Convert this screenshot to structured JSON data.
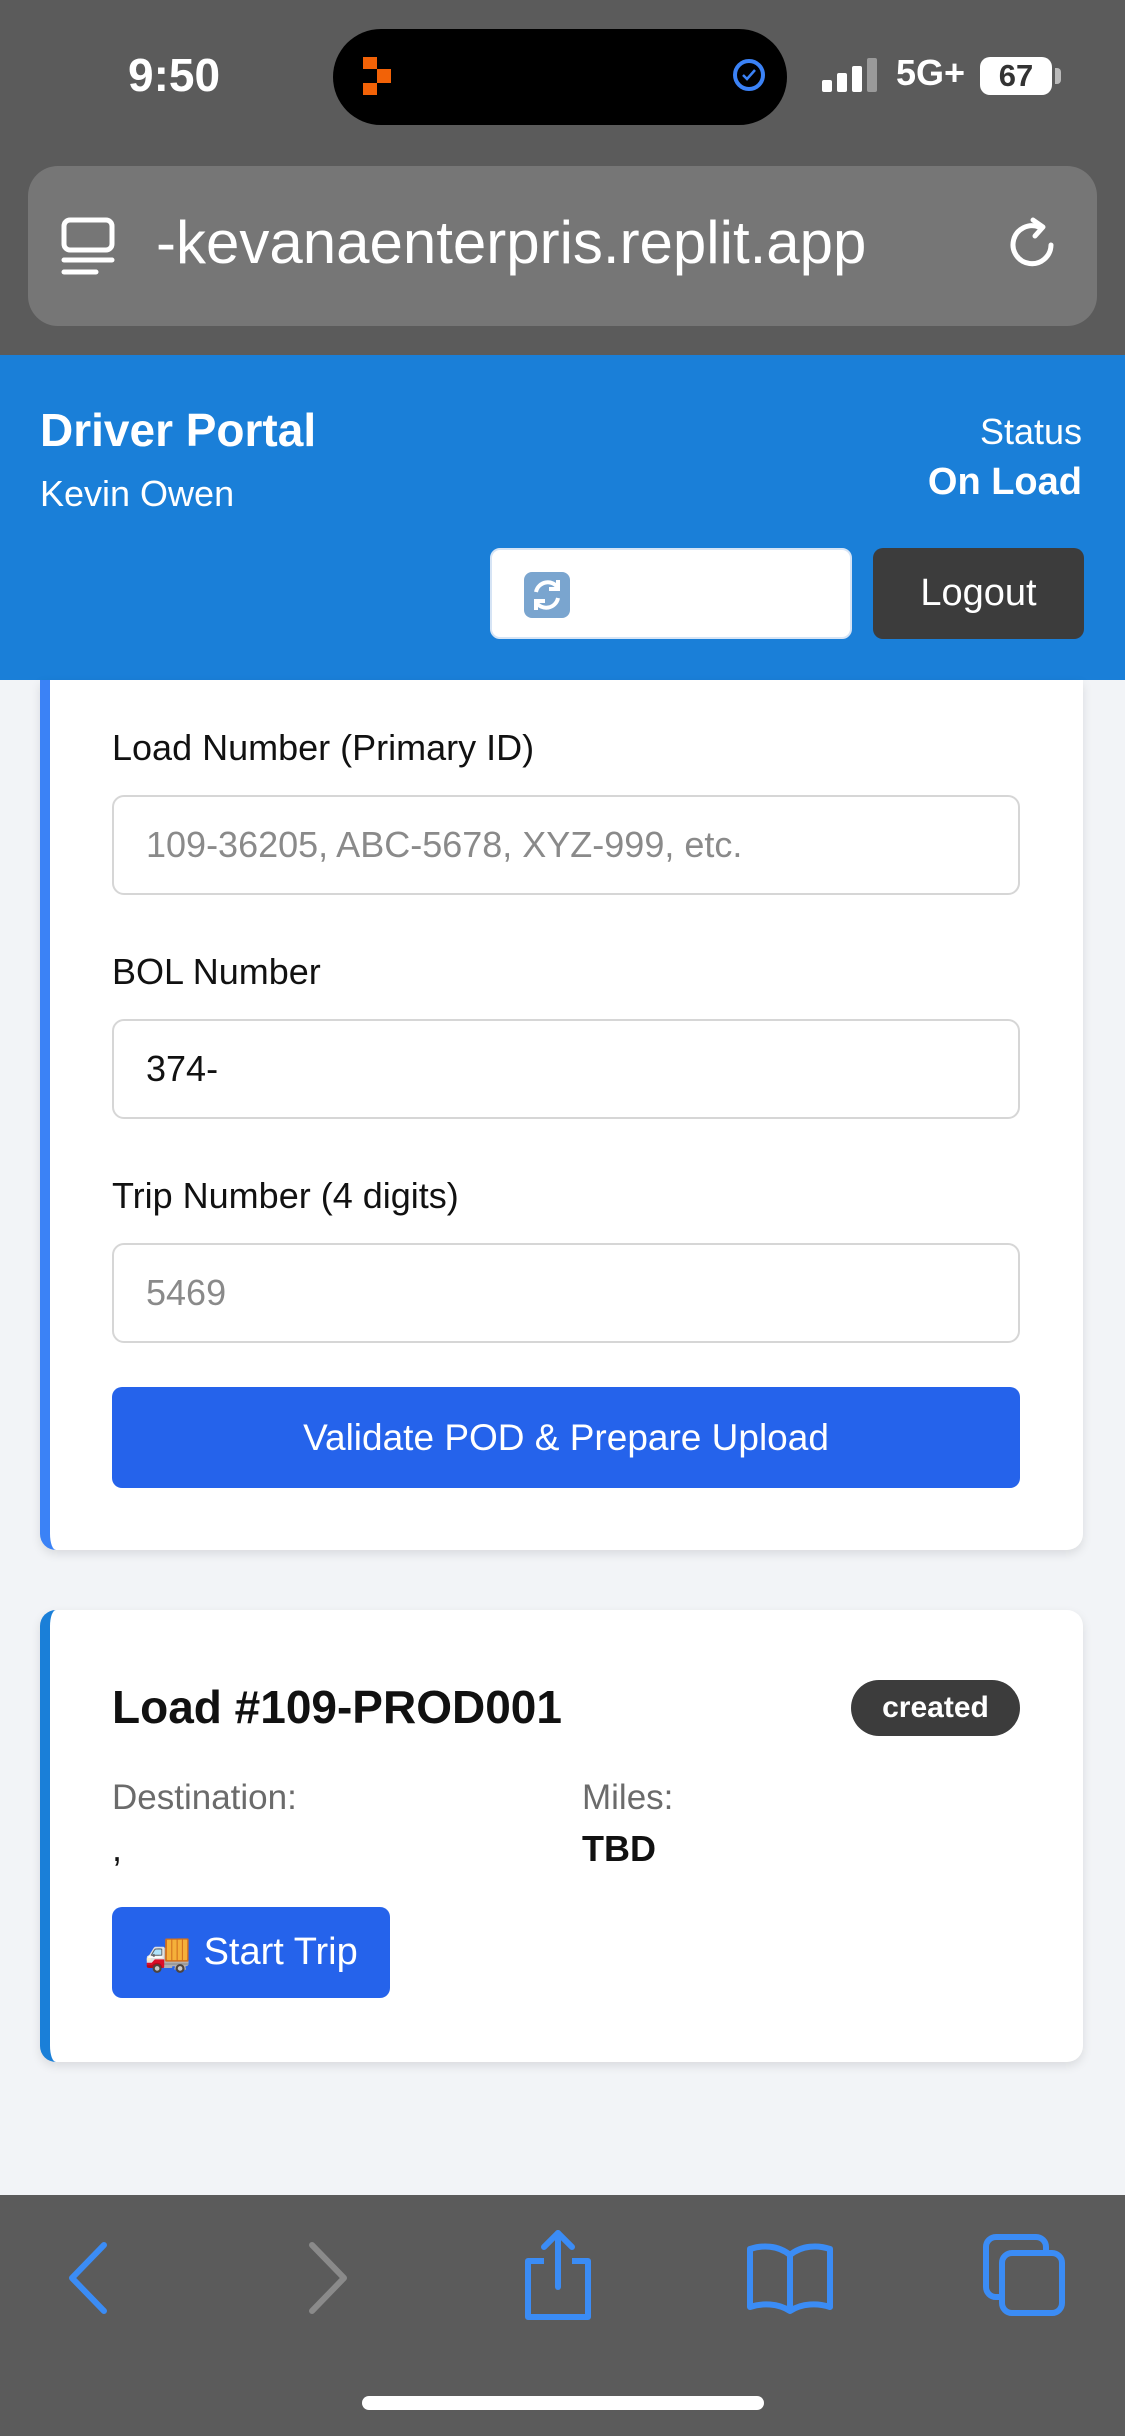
{
  "status_bar": {
    "time": "9:50",
    "network": "5G+",
    "battery": "67"
  },
  "browser": {
    "url": "-kevanaenterpris.replit.app"
  },
  "header": {
    "title": "Driver Portal",
    "driver_name": "Kevin Owen",
    "status_label": "Status",
    "status_value": "On Load",
    "logout_label": "Logout"
  },
  "form": {
    "load_number_label": "Load Number (Primary ID)",
    "load_number_placeholder": "109-36205, ABC-5678, XYZ-999, etc.",
    "bol_label": "BOL Number",
    "bol_value": "374-",
    "trip_label": "Trip Number (4 digits)",
    "trip_placeholder": "5469",
    "validate_label": "Validate POD & Prepare Upload"
  },
  "load_card": {
    "title": "Load #109-PROD001",
    "badge": "created",
    "destination_label": "Destination:",
    "destination_value": ",",
    "miles_label": "Miles:",
    "miles_value": "TBD",
    "start_icon": "🚚",
    "start_label": "Start Trip"
  },
  "colors": {
    "header_blue": "#1a7fd8",
    "button_blue": "#2563eb",
    "dark": "#3c3c3c"
  }
}
